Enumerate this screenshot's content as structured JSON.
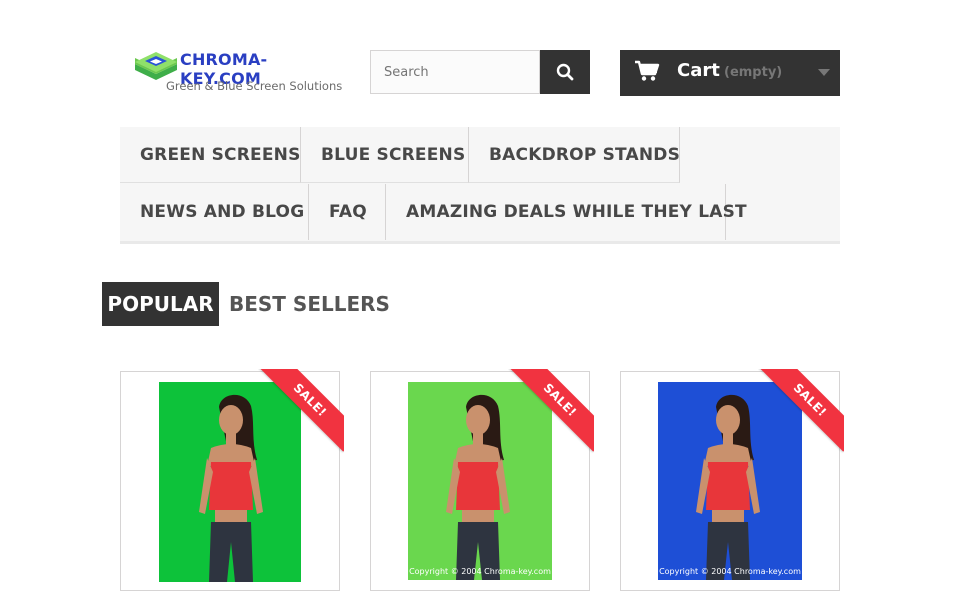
{
  "header": {
    "logo": {
      "title": "CHROMA-KEY.COM",
      "subtitle": "Green & Blue Screen Solutions"
    },
    "search": {
      "placeholder": "Search"
    },
    "cart": {
      "label": "Cart",
      "status": "(empty)"
    }
  },
  "menu": {
    "row1": [
      "GREEN SCREENS",
      "BLUE SCREENS",
      "BACKDROP STANDS"
    ],
    "row2": [
      "NEWS AND BLOG",
      "FAQ",
      "AMAZING DEALS WHILE THEY LAST"
    ]
  },
  "tabs": {
    "popular": "POPULAR",
    "best_sellers": "BEST SELLERS"
  },
  "products": [
    {
      "badge": "SALE!",
      "backdrop_color": "#0dc23a",
      "copyright": ""
    },
    {
      "badge": "SALE!",
      "backdrop_color": "#6ad74e",
      "copyright": "Copyright © 2004 Chroma-key.com"
    },
    {
      "badge": "SALE!",
      "backdrop_color": "#1e4fd6",
      "copyright": "Copyright © 2004 Chroma-key.com"
    }
  ],
  "colors": {
    "dark": "#333333",
    "sale": "#f13340",
    "logo_blue": "#2a3fc2",
    "logo_green": "#3fbf4a"
  }
}
